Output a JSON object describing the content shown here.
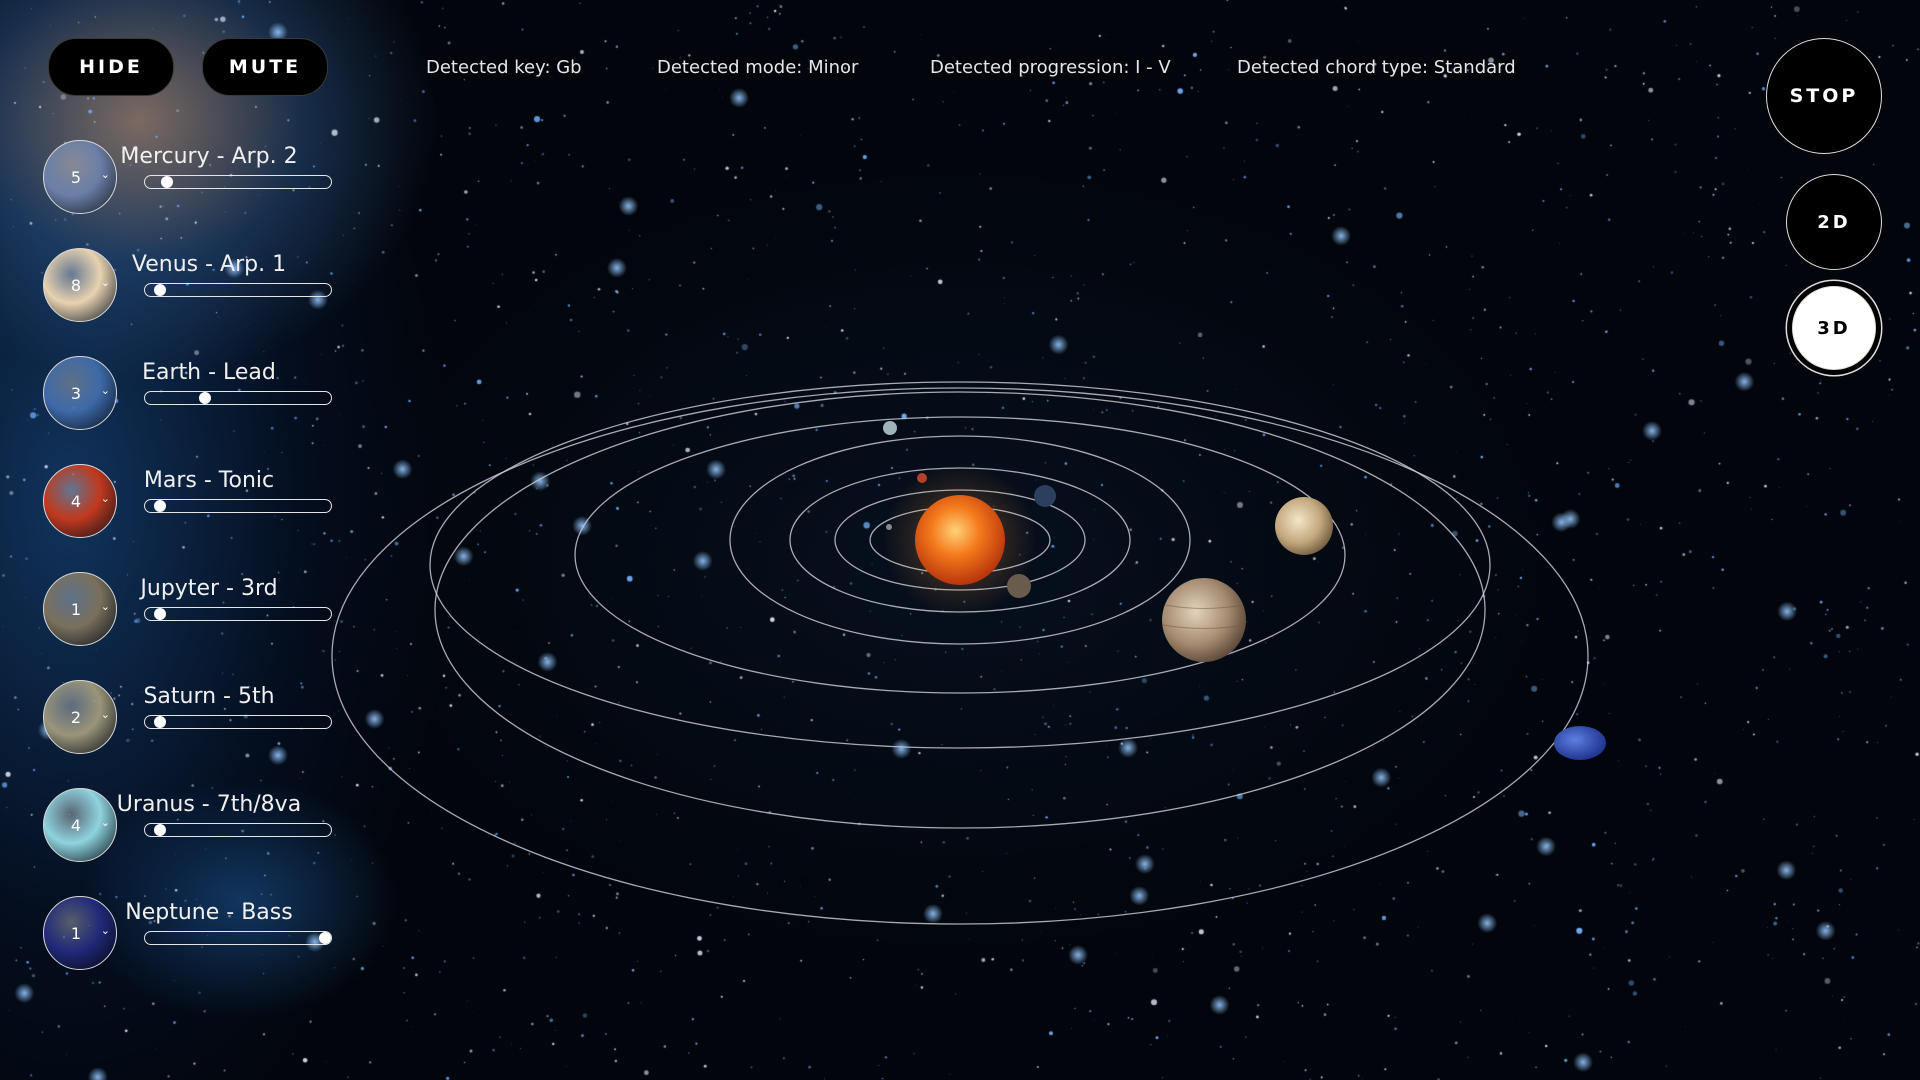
{
  "controls": {
    "hide_label": "HIDE",
    "mute_label": "MUTE",
    "stop_label": "STOP",
    "view_2d_label": "2D",
    "view_3d_label": "3D",
    "active_view": "3D"
  },
  "detected": {
    "key": "Detected key: Gb",
    "mode": "Detected mode: Minor",
    "progression": "Detected progression: I - V",
    "chord_type": "Detected chord type: Standard"
  },
  "tracks": [
    {
      "label": "Mercury - Arp. 2",
      "number": "5",
      "volume": 0.12,
      "color": "#6b7fa8"
    },
    {
      "label": "Venus - Arp. 1",
      "number": "8",
      "volume": 0.08,
      "color": "#e8d2b0"
    },
    {
      "label": "Earth - Lead",
      "number": "3",
      "volume": 0.32,
      "color": "#3f6aa8"
    },
    {
      "label": "Mars - Tonic",
      "number": "4",
      "volume": 0.08,
      "color": "#c2391e"
    },
    {
      "label": "Jupyter - 3rd",
      "number": "1",
      "volume": 0.08,
      "color": "#7a705c"
    },
    {
      "label": "Saturn - 5th",
      "number": "2",
      "volume": 0.08,
      "color": "#9a957a"
    },
    {
      "label": "Uranus - 7th/8va",
      "number": "4",
      "volume": 0.08,
      "color": "#8fd4de"
    },
    {
      "label": "Neptune - Bass",
      "number": "1",
      "volume": 0.97,
      "color": "#222a7a"
    }
  ],
  "icons": {
    "dropdown": "chevron-down-icon"
  }
}
